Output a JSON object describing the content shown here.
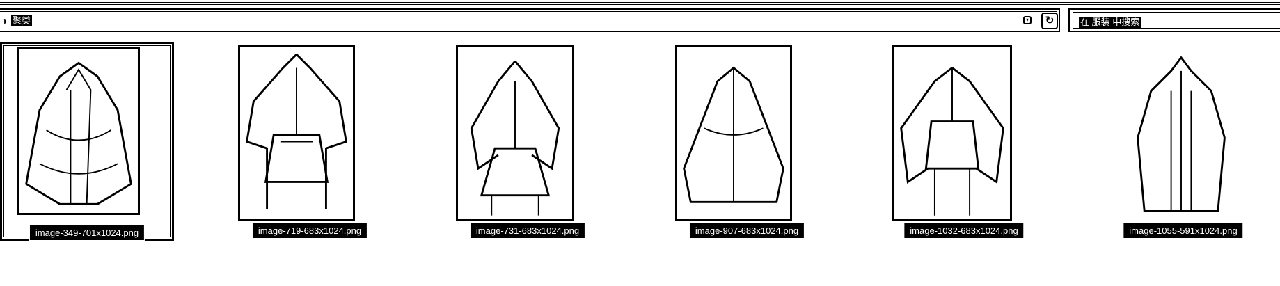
{
  "address_bar": {
    "path_label": "聚类",
    "nav_icon": "folder-nav-icon",
    "dropdown_icon": "chevron-down-icon",
    "refresh_icon": "refresh-icon"
  },
  "search": {
    "placeholder": "在 服装 中搜索"
  },
  "files": [
    {
      "name": "image-349-701x1024.png",
      "selected": true
    },
    {
      "name": "image-719-683x1024.png",
      "selected": false
    },
    {
      "name": "image-731-683x1024.png",
      "selected": false
    },
    {
      "name": "image-907-683x1024.png",
      "selected": false
    },
    {
      "name": "image-1032-683x1024.png",
      "selected": false
    },
    {
      "name": "image-1055-591x1024.png",
      "selected": false
    }
  ]
}
